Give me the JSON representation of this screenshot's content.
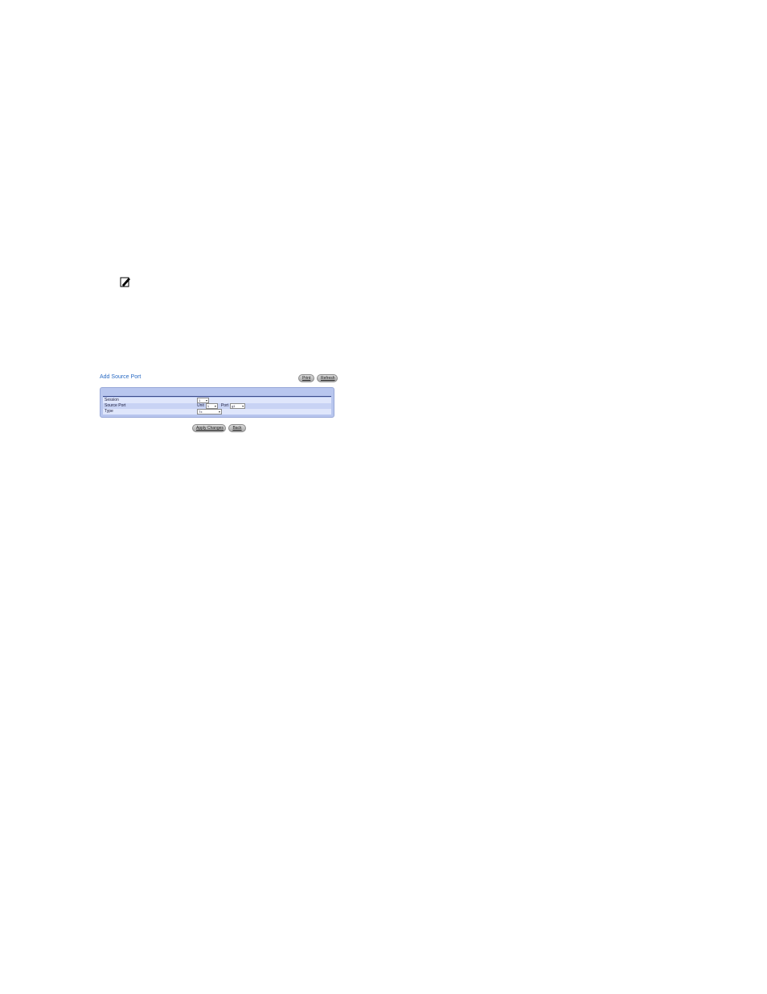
{
  "note": {
    "icon": "note-pencil-icon"
  },
  "panel": {
    "title": "Add Source Port",
    "print_label": "Print",
    "refresh_label": "Refresh"
  },
  "form": {
    "rows": [
      {
        "label": "Session",
        "value": "1"
      },
      {
        "label": "Source Port",
        "unit_label": "Unit",
        "unit_value": "1",
        "port_label": "Port",
        "port_value": "g1"
      },
      {
        "label": "Type",
        "value": "Tx"
      }
    ]
  },
  "actions": {
    "apply_label": "Apply Changes",
    "back_label": "Back"
  },
  "colors": {
    "title": "#2a6bc4",
    "panel_bg": "#b8c6ee",
    "row_light": "#dfe6fb",
    "row_dark": "#c8d3f4"
  }
}
